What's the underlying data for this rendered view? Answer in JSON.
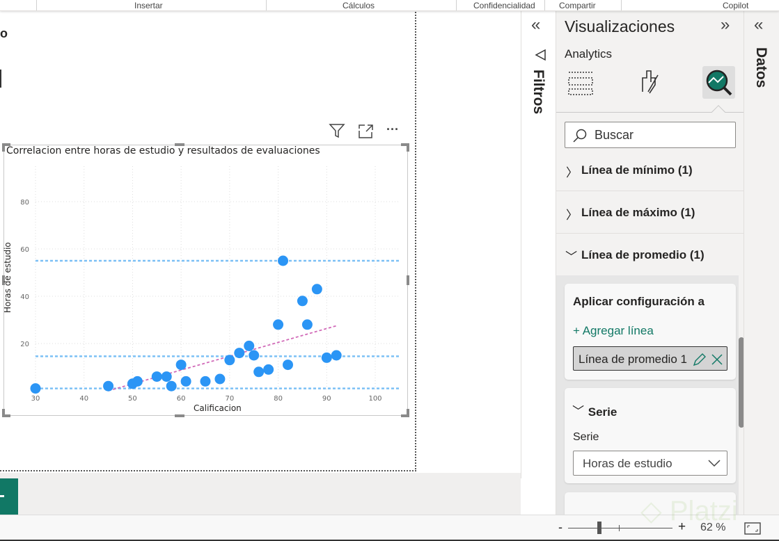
{
  "ribbon": {
    "groups": [
      "Insertar",
      "Cálculos",
      "Confidencialidad",
      "Compartir",
      "Copilot"
    ]
  },
  "canvas": {
    "heading_fragment": "o"
  },
  "visual_header": {
    "filter_icon": "filter-icon",
    "focus_icon": "focus-mode-icon",
    "more_label": "···"
  },
  "chart_data": {
    "type": "scatter",
    "title": "Correlacion entre horas de estudio y resultados de evaluaciones",
    "xlabel": "Calificacion",
    "ylabel": "Horas de estudio",
    "xlim": [
      30,
      105
    ],
    "ylim": [
      0,
      95
    ],
    "xticks": [
      30,
      40,
      50,
      60,
      70,
      80,
      90,
      100
    ],
    "yticks": [
      20,
      40,
      60,
      80
    ],
    "grid": true,
    "points": [
      [
        30,
        1
      ],
      [
        45,
        2
      ],
      [
        50,
        3
      ],
      [
        51,
        4
      ],
      [
        55,
        6
      ],
      [
        57,
        6
      ],
      [
        58,
        2
      ],
      [
        60,
        11
      ],
      [
        61,
        4
      ],
      [
        65,
        4
      ],
      [
        68,
        5
      ],
      [
        70,
        13
      ],
      [
        72,
        16
      ],
      [
        74,
        19
      ],
      [
        75,
        15
      ],
      [
        76,
        8
      ],
      [
        78,
        9
      ],
      [
        80,
        28
      ],
      [
        81,
        55
      ],
      [
        82,
        11
      ],
      [
        85,
        38
      ],
      [
        86,
        28
      ],
      [
        88,
        43
      ],
      [
        90,
        14
      ],
      [
        92,
        15
      ]
    ],
    "point_color": "#2b95f5",
    "reference_lines": [
      {
        "name": "max",
        "value": 55,
        "color": "#7cc0f5"
      },
      {
        "name": "average",
        "value": 14.6,
        "color": "#7cc0f5"
      },
      {
        "name": "min",
        "value": 1,
        "color": "#7cc0f5"
      }
    ],
    "trend_line": {
      "from": [
        45,
        0
      ],
      "to": [
        92,
        27.5
      ],
      "color": "#d16ab8"
    }
  },
  "filters": {
    "collapse_label": "«",
    "title": "Filtros"
  },
  "viz": {
    "title": "Visualizaciones",
    "expand_label": "»",
    "subtitle": "Analytics",
    "search_placeholder": "Buscar",
    "sections": [
      "Línea de mínimo (1)",
      "Línea de máximo (1)",
      "Línea de promedio (1)"
    ],
    "apply_title": "Aplicar configuración a",
    "add_line": "+ Agregar línea",
    "selected_line": "Línea de promedio 1",
    "serie_header": "Serie",
    "serie_label": "Serie",
    "serie_value": "Horas de estudio"
  },
  "datos": {
    "collapse_label": "«",
    "title": "Datos"
  },
  "status": {
    "minus": "-",
    "plus": "+",
    "zoom": "62 %",
    "zoom_fraction": 0.3
  },
  "watermark": "Platzi",
  "colors": {
    "accent": "#117865",
    "pane": "#f3f2f1"
  }
}
